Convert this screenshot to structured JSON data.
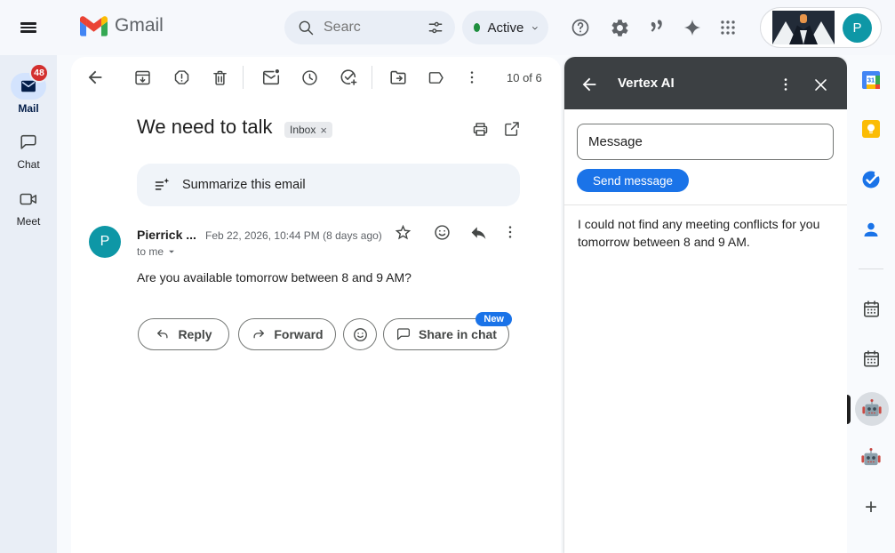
{
  "colors": {
    "accent_blue": "#1a73e8",
    "panel_header_dark": "#3c4043",
    "badge_red": "#d3302f",
    "avatar_teal": "#0e97a6",
    "active_green": "#1e8e3e",
    "mail_pill_blue": "#d3e3fd"
  },
  "header": {
    "app_name": "Gmail",
    "search_placeholder": "Searc",
    "status_label": "Active",
    "profile_initial": "P"
  },
  "nav": {
    "items": [
      {
        "label": "Mail",
        "badge": "48"
      },
      {
        "label": "Chat"
      },
      {
        "label": "Meet"
      }
    ]
  },
  "toolbar": {
    "pagination": "10 of 6"
  },
  "email": {
    "subject": "We need to talk",
    "label_chip": "Inbox",
    "label_close_glyph": "×",
    "summarize_label": "Summarize this email",
    "sender_name": "Pierrick ...",
    "sender_initial": "P",
    "date": "Feb 22, 2026, 10:44 PM (8 days ago)",
    "recipient": "to me",
    "body": "Are you available tomorrow between 8 and 9 AM?",
    "actions": {
      "reply": "Reply",
      "forward": "Forward",
      "share": "Share in chat",
      "new_badge": "New"
    }
  },
  "panel": {
    "title": "Vertex AI",
    "input_value": "Message",
    "send_label": "Send message",
    "response": "I could not find any meeting conflicts for you tomorrow between 8 and 9 AM."
  },
  "right_rail": {
    "calendar_day": "31",
    "plus_glyph": "+"
  }
}
